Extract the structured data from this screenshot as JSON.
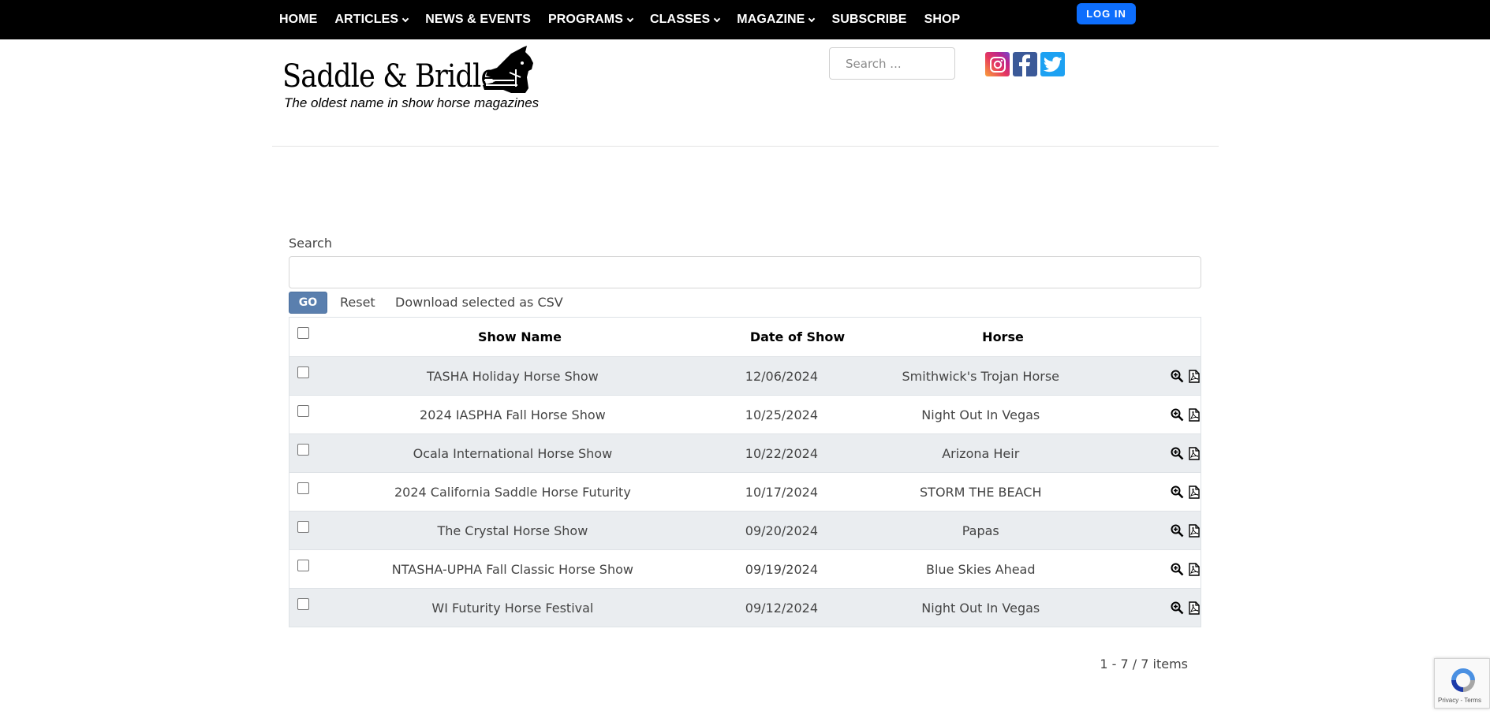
{
  "nav": {
    "items": [
      {
        "label": "HOME",
        "dropdown": false
      },
      {
        "label": "ARTICLES",
        "dropdown": true
      },
      {
        "label": "NEWS & EVENTS",
        "dropdown": false
      },
      {
        "label": "PROGRAMS",
        "dropdown": true
      },
      {
        "label": "CLASSES",
        "dropdown": true
      },
      {
        "label": "MAGAZINE",
        "dropdown": true
      },
      {
        "label": "SUBSCRIBE",
        "dropdown": false
      },
      {
        "label": "SHOP",
        "dropdown": false
      }
    ],
    "login_label": "LOG IN"
  },
  "header": {
    "logo_name": "Saddle & Bridle",
    "logo_tagline": "The oldest name in show horse magazines",
    "search_placeholder": "Search ...",
    "social_icons": [
      "instagram-icon",
      "facebook-icon",
      "twitter-icon"
    ]
  },
  "results": {
    "search_label": "Search",
    "search_value": "",
    "go_label": "GO",
    "reset_label": "Reset",
    "download_label": "Download selected as CSV",
    "columns": [
      "Show Name",
      "Date of Show",
      "Horse"
    ],
    "rows": [
      {
        "show": "TASHA Holiday Horse Show",
        "date": "12/06/2024",
        "horse": "Smithwick's Trojan Horse"
      },
      {
        "show": "2024 IASPHA Fall Horse Show",
        "date": "10/25/2024",
        "horse": "Night Out In Vegas"
      },
      {
        "show": "Ocala International Horse Show",
        "date": "10/22/2024",
        "horse": "Arizona Heir"
      },
      {
        "show": "2024 California Saddle Horse Futurity",
        "date": "10/17/2024",
        "horse": "STORM THE BEACH"
      },
      {
        "show": "The Crystal Horse Show",
        "date": "09/20/2024",
        "horse": "Papas"
      },
      {
        "show": "NTASHA-UPHA Fall Classic Horse Show",
        "date": "09/19/2024",
        "horse": "Blue Skies Ahead"
      },
      {
        "show": "WI Futurity Horse Festival",
        "date": "09/12/2024",
        "horse": "Night Out In Vegas"
      }
    ],
    "row_action_icons": [
      "zoom-in-icon",
      "pdf-icon"
    ],
    "pager_text": "1 - 7 / 7 items"
  },
  "recaptcha": {
    "text": "Privacy - Terms"
  },
  "colors": {
    "topbar": "#000000",
    "login": "#0d6efd",
    "go_button": "#5a7fae",
    "row_alt": "#eaedf0"
  }
}
